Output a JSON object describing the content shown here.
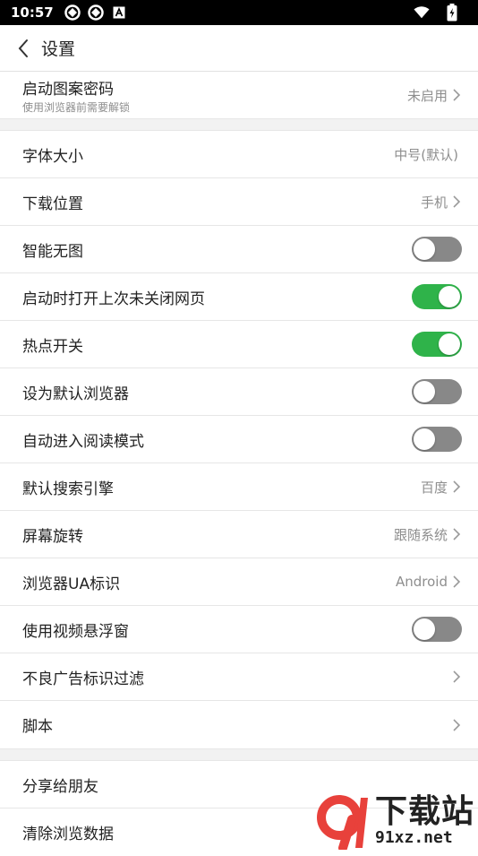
{
  "status_bar": {
    "time": "10:57"
  },
  "header": {
    "title": "设置"
  },
  "groups": {
    "security": {
      "pattern_lock": {
        "label": "启动图案密码",
        "sub": "使用浏览器前需要解锁",
        "value": "未启用"
      }
    },
    "general": {
      "font_size": {
        "label": "字体大小",
        "value": "中号(默认)"
      },
      "download_location": {
        "label": "下载位置",
        "value": "手机"
      },
      "smart_no_image": {
        "label": "智能无图",
        "state": "off"
      },
      "restore_tabs": {
        "label": "启动时打开上次未关闭网页",
        "state": "on"
      },
      "hotspot": {
        "label": "热点开关",
        "state": "on"
      },
      "default_browser": {
        "label": "设为默认浏览器",
        "state": "off"
      },
      "auto_reading_mode": {
        "label": "自动进入阅读模式",
        "state": "off"
      },
      "search_engine": {
        "label": "默认搜索引擎",
        "value": "百度"
      },
      "screen_rotation": {
        "label": "屏幕旋转",
        "value": "跟随系统"
      },
      "user_agent": {
        "label": "浏览器UA标识",
        "value": "Android"
      },
      "floating_video": {
        "label": "使用视频悬浮窗",
        "state": "off"
      },
      "ad_filter": {
        "label": "不良广告标识过滤"
      },
      "scripts": {
        "label": "脚本"
      }
    },
    "other": {
      "share": {
        "label": "分享给朋友"
      },
      "clear_data": {
        "label": "清除浏览数据"
      }
    }
  },
  "watermark": {
    "logo_text": "9",
    "text_cn": "下载站",
    "text_en": "91xz.net"
  },
  "colors": {
    "toggle_on": "#2fb34a",
    "toggle_off": "#888888",
    "watermark_red": "#e8413b"
  }
}
